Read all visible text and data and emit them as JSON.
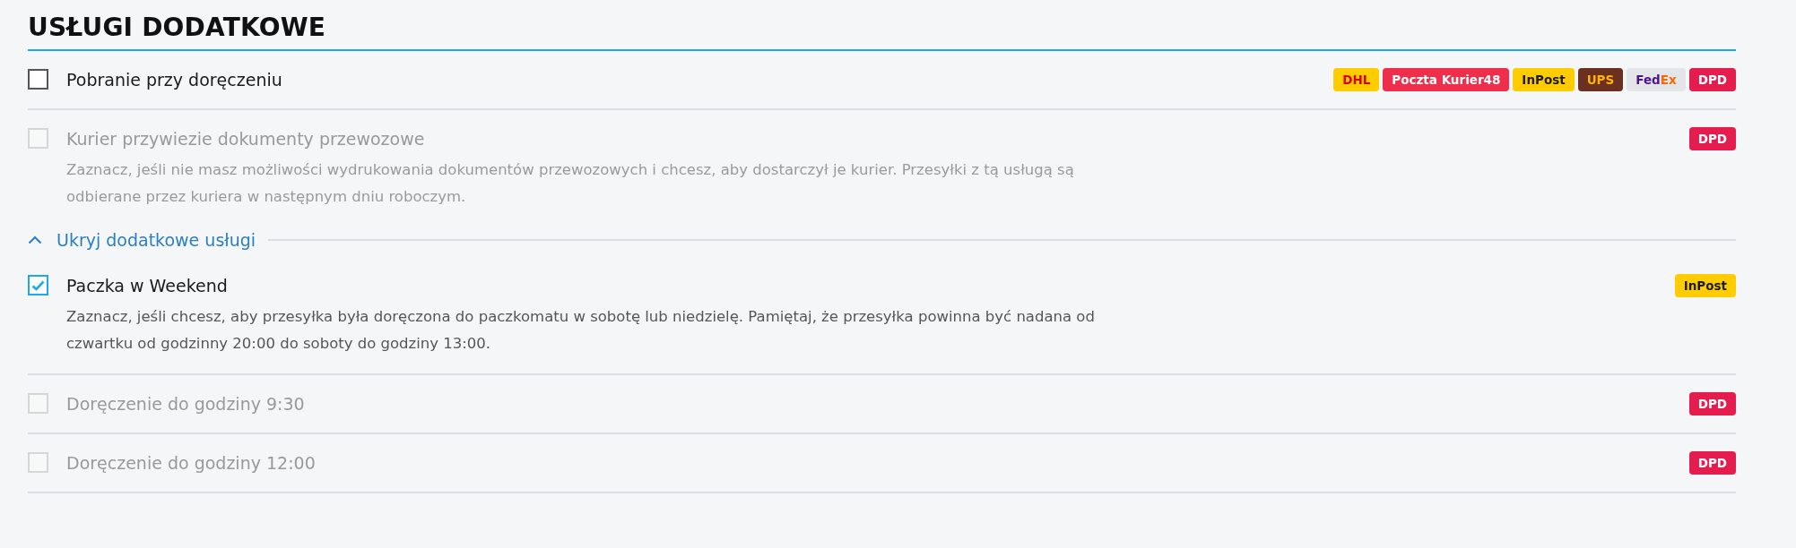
{
  "title": "USŁUGI DODATKOWE",
  "options": [
    {
      "label": "Pobranie przy doręczeniu",
      "checked": false,
      "disabled": false,
      "badges": [
        {
          "parts": [
            {
              "text": "DHL",
              "color": "#d40511"
            }
          ],
          "color": "#ffcc00"
        },
        {
          "parts": [
            {
              "text": "Poczta Kurier48",
              "color": "#ffffff"
            }
          ],
          "color": "#ee2e4a"
        },
        {
          "parts": [
            {
              "text": "InPost",
              "color": "#1d1d1b"
            }
          ],
          "color": "#ffcc00"
        },
        {
          "parts": [
            {
              "text": "UPS",
              "color": "#ffb500"
            }
          ],
          "color": "#6b3020"
        },
        {
          "parts": [
            {
              "text": "Fed",
              "color": "#4d148c"
            },
            {
              "text": "Ex",
              "color": "#ff6600"
            }
          ],
          "color": "#e4e5e8"
        },
        {
          "parts": [
            {
              "text": "DPD",
              "color": "#ffffff"
            }
          ],
          "color": "#e51d4f"
        }
      ]
    },
    {
      "label": "Kurier przywiezie dokumenty przewozowe",
      "checked": false,
      "disabled": true,
      "description": "Zaznacz, jeśli nie masz możliwości wydrukowania dokumentów przewozowych i chcesz, aby dostarczył je kurier. Przesyłki z tą usługą są odbierane przez kuriera w następnym dniu roboczym.",
      "badges": [
        {
          "parts": [
            {
              "text": "DPD",
              "color": "#ffffff"
            }
          ],
          "color": "#e51d4f"
        }
      ]
    }
  ],
  "toggle": {
    "label": "Ukryj dodatkowe usługi",
    "expanded": true
  },
  "more_options": [
    {
      "label": "Paczka w Weekend",
      "checked": true,
      "disabled": false,
      "description": "Zaznacz, jeśli chcesz, aby przesyłka była doręczona do paczkomatu w sobotę lub niedzielę. Pamiętaj, że przesyłka powinna być nadana od czwartku od godzinny 20:00 do soboty do godziny 13:00.",
      "badges": [
        {
          "parts": [
            {
              "text": "InPost",
              "color": "#1d1d1b"
            }
          ],
          "color": "#ffcc00"
        }
      ]
    },
    {
      "label": "Doręczenie do godziny 9:30",
      "checked": false,
      "disabled": true,
      "badges": [
        {
          "parts": [
            {
              "text": "DPD",
              "color": "#ffffff"
            }
          ],
          "color": "#e51d4f"
        }
      ]
    },
    {
      "label": "Doręczenie do godziny 12:00",
      "checked": false,
      "disabled": true,
      "badges": [
        {
          "parts": [
            {
              "text": "DPD",
              "color": "#ffffff"
            }
          ],
          "color": "#e51d4f"
        }
      ]
    }
  ]
}
